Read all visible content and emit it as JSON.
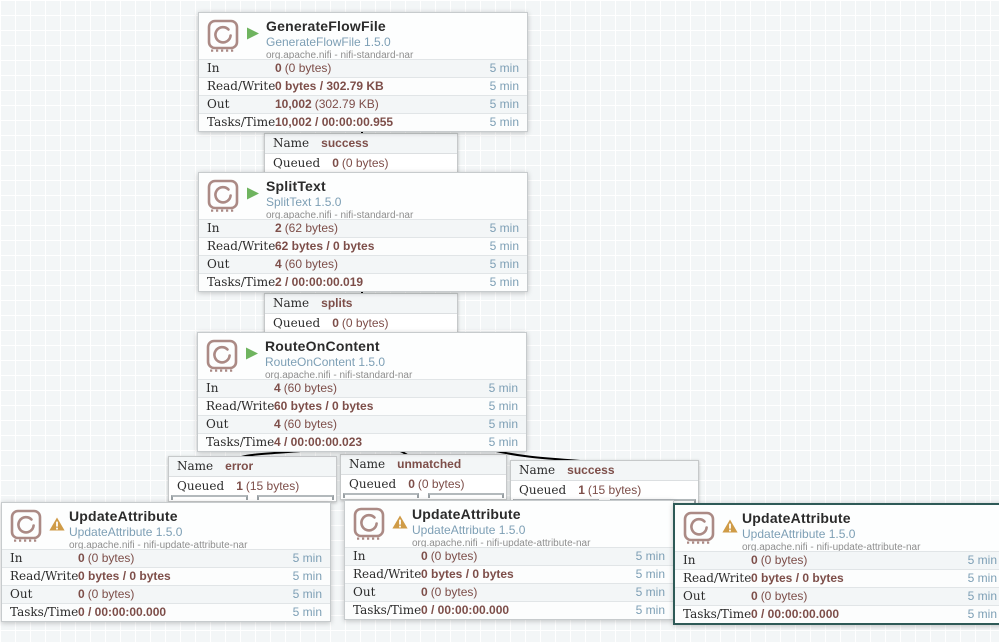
{
  "app": "Apache NiFi flow canvas",
  "window_label": "5 min",
  "colors": {
    "value_maroon": "#7d4e49",
    "time_blue": "#7d9fb5",
    "type_blue": "#7d9fb5",
    "bundle_gray": "#8e8e8e",
    "run_green": "#6fb45f",
    "warning_amber": "#cf9b47",
    "selected_teal": "#2e5a57",
    "icon_rose": "#ab8a85"
  },
  "icons": {
    "processor": "nifi-processor-stamp-icon",
    "running": "play-triangle-icon",
    "invalid": "warning-triangle-icon"
  },
  "processors": [
    {
      "name": "GenerateFlowFile",
      "type": "GenerateFlowFile 1.5.0",
      "bundle": "org.apache.nifi - nifi-standard-nar",
      "status": "running",
      "rows": [
        {
          "label": "In",
          "value": "0",
          "detail": "(0 bytes)",
          "window": "5 min"
        },
        {
          "label": "Read/Write",
          "value": "0 bytes / 302.79 KB",
          "detail": "",
          "window": "5 min"
        },
        {
          "label": "Out",
          "value": "10,002",
          "detail": "(302.79 KB)",
          "window": "5 min"
        },
        {
          "label": "Tasks/Time",
          "value": "10,002 / 00:00:00.955",
          "detail": "",
          "window": "5 min"
        }
      ]
    },
    {
      "name": "SplitText",
      "type": "SplitText 1.5.0",
      "bundle": "org.apache.nifi - nifi-standard-nar",
      "status": "running",
      "rows": [
        {
          "label": "In",
          "value": "2",
          "detail": "(62 bytes)",
          "window": "5 min"
        },
        {
          "label": "Read/Write",
          "value": "62 bytes / 0 bytes",
          "detail": "",
          "window": "5 min"
        },
        {
          "label": "Out",
          "value": "4",
          "detail": "(60 bytes)",
          "window": "5 min"
        },
        {
          "label": "Tasks/Time",
          "value": "2 / 00:00:00.019",
          "detail": "",
          "window": "5 min"
        }
      ]
    },
    {
      "name": "RouteOnContent",
      "type": "RouteOnContent 1.5.0",
      "bundle": "org.apache.nifi - nifi-standard-nar",
      "status": "running",
      "rows": [
        {
          "label": "In",
          "value": "4",
          "detail": "(60 bytes)",
          "window": "5 min"
        },
        {
          "label": "Read/Write",
          "value": "60 bytes / 0 bytes",
          "detail": "",
          "window": "5 min"
        },
        {
          "label": "Out",
          "value": "4",
          "detail": "(60 bytes)",
          "window": "5 min"
        },
        {
          "label": "Tasks/Time",
          "value": "4 / 00:00:00.023",
          "detail": "",
          "window": "5 min"
        }
      ]
    },
    {
      "name": "UpdateAttribute",
      "type": "UpdateAttribute 1.5.0",
      "bundle": "org.apache.nifi - nifi-update-attribute-nar",
      "status": "invalid",
      "rows": [
        {
          "label": "In",
          "value": "0",
          "detail": "(0 bytes)",
          "window": "5 min"
        },
        {
          "label": "Read/Write",
          "value": "0 bytes / 0 bytes",
          "detail": "",
          "window": "5 min"
        },
        {
          "label": "Out",
          "value": "0",
          "detail": "(0 bytes)",
          "window": "5 min"
        },
        {
          "label": "Tasks/Time",
          "value": "0 / 00:00:00.000",
          "detail": "",
          "window": "5 min"
        }
      ]
    },
    {
      "name": "UpdateAttribute",
      "type": "UpdateAttribute 1.5.0",
      "bundle": "org.apache.nifi - nifi-update-attribute-nar",
      "status": "invalid",
      "rows": [
        {
          "label": "In",
          "value": "0",
          "detail": "(0 bytes)",
          "window": "5 min"
        },
        {
          "label": "Read/Write",
          "value": "0 bytes / 0 bytes",
          "detail": "",
          "window": "5 min"
        },
        {
          "label": "Out",
          "value": "0",
          "detail": "(0 bytes)",
          "window": "5 min"
        },
        {
          "label": "Tasks/Time",
          "value": "0 / 00:00:00.000",
          "detail": "",
          "window": "5 min"
        }
      ]
    },
    {
      "name": "UpdateAttribute",
      "type": "UpdateAttribute 1.5.0",
      "bundle": "org.apache.nifi - nifi-update-attribute-nar",
      "status": "invalid",
      "selected": true,
      "rows": [
        {
          "label": "In",
          "value": "0",
          "detail": "(0 bytes)",
          "window": "5 min"
        },
        {
          "label": "Read/Write",
          "value": "0 bytes / 0 bytes",
          "detail": "",
          "window": "5 min"
        },
        {
          "label": "Out",
          "value": "0",
          "detail": "(0 bytes)",
          "window": "5 min"
        },
        {
          "label": "Tasks/Time",
          "value": "0 / 00:00:00.000",
          "detail": "",
          "window": "5 min"
        }
      ]
    }
  ],
  "connection_labels": [
    {
      "name_label": "Name",
      "name": "success",
      "queued_label": "Queued",
      "count": "0",
      "size": "(0 bytes)"
    },
    {
      "name_label": "Name",
      "name": "splits",
      "queued_label": "Queued",
      "count": "0",
      "size": "(0 bytes)"
    },
    {
      "name_label": "Name",
      "name": "error",
      "queued_label": "Queued",
      "count": "1",
      "size": "(15 bytes)"
    },
    {
      "name_label": "Name",
      "name": "unmatched",
      "queued_label": "Queued",
      "count": "0",
      "size": "(0 bytes)"
    },
    {
      "name_label": "Name",
      "name": "success",
      "queued_label": "Queued",
      "count": "1",
      "size": "(15 bytes)"
    }
  ]
}
